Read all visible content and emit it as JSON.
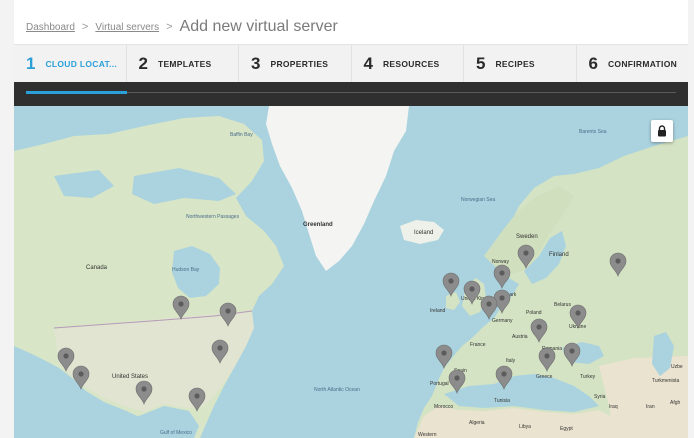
{
  "breadcrumb": {
    "items": [
      "Dashboard",
      "Virtual servers"
    ],
    "separator": ">",
    "current": "Add new virtual server"
  },
  "wizard": {
    "steps": [
      {
        "num": "1",
        "label": "CLOUD LOCAT..."
      },
      {
        "num": "2",
        "label": "TEMPLATES"
      },
      {
        "num": "3",
        "label": "PROPERTIES"
      },
      {
        "num": "4",
        "label": "RESOURCES"
      },
      {
        "num": "5",
        "label": "RECIPES"
      },
      {
        "num": "6",
        "label": "CONFIRMATION"
      }
    ],
    "active_step": 1,
    "progress": 0.155
  },
  "map": {
    "labels": {
      "baffin_bay": "Baffin Bay",
      "barents_sea": "Barents Sea",
      "northwestern_passages": "Northwestern Passages",
      "greenland": "Greenland",
      "iceland": "Iceland",
      "norwegian_sea": "Norwegian Sea",
      "sweden": "Sweden",
      "finland": "Finland",
      "norway": "Norway",
      "canada": "Canada",
      "hudson_bay": "Hudson Bay",
      "united_kingdom": "United Kingdom",
      "ireland": "Ireland",
      "denmark": "Denmark",
      "germany": "Germany",
      "poland": "Poland",
      "belarus": "Belarus",
      "ukraine": "Ukraine",
      "france": "France",
      "austria": "Austria",
      "romania": "Romania",
      "italy": "Italy",
      "spain": "Spain",
      "portugal": "Portugal",
      "greece": "Greece",
      "turkey": "Turkey",
      "united_states": "United States",
      "north_atlantic_ocean": "North Atlantic Ocean",
      "morocco": "Morocco",
      "algeria": "Algeria",
      "libya": "Libya",
      "egypt": "Egypt",
      "tunisia": "Tunisia",
      "syria": "Syria",
      "iraq": "Iraq",
      "iran": "Iran",
      "gulf_of_mexico": "Gulf of Mexico",
      "uzbekistan": "Uzbe",
      "turkmenistan": "Turkmenista",
      "afghanistan": "Afgh",
      "western_sahara": "Western"
    },
    "lock_icon": "lock-icon",
    "pin_color": "#8c8c8c",
    "water_color": "#aad3df",
    "land_color": "#d9e6c8"
  },
  "colors": {
    "accent": "#2a9fd8",
    "dark_bar": "#2f2f2f"
  }
}
